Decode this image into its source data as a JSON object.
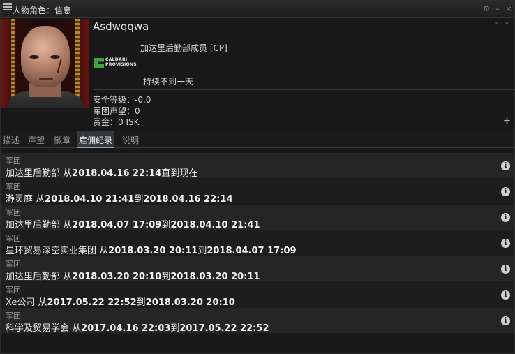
{
  "window": {
    "title": "人物角色：信息",
    "controls": {
      "settings": "⚙",
      "minimize": "–",
      "close": "×"
    },
    "nav_arrows": "« »"
  },
  "character": {
    "name": "Asdwqqwa",
    "corporation": "加达里后勤部成员 [CP]",
    "corp_logo_text": [
      "CALDARI",
      "PROVISIONS"
    ],
    "duration": "持续不到一天",
    "stats": {
      "security": "安全等级：-0.0",
      "corp_standing": "军团声望：0",
      "bounty": "赏金：0 ISK"
    }
  },
  "tabs": [
    {
      "label": "描述",
      "active": false
    },
    {
      "label": "声望",
      "active": false
    },
    {
      "label": "徽章",
      "active": false
    },
    {
      "label": "雇佣纪录",
      "active": true
    },
    {
      "label": "说明",
      "active": false
    }
  ],
  "history": [
    {
      "type": "军团",
      "corp": "加达里后勤部",
      "from_word": "从",
      "start": "2018.04.16 22:14",
      "to_word": "直到现在",
      "end": ""
    },
    {
      "type": "军团",
      "corp": "瀞灵庭",
      "from_word": "从",
      "start": "2018.04.10 21:41",
      "to_word": "到",
      "end": "2018.04.16 22:14"
    },
    {
      "type": "军团",
      "corp": "加达里后勤部",
      "from_word": "从",
      "start": "2018.04.07 17:09",
      "to_word": "到",
      "end": "2018.04.10 21:41"
    },
    {
      "type": "军团",
      "corp": "星环贸易深空实业集团",
      "from_word": "从",
      "start": "2018.03.20 20:11",
      "to_word": "到",
      "end": "2018.04.07 17:09"
    },
    {
      "type": "军团",
      "corp": "加达里后勤部",
      "from_word": "从",
      "start": "2018.03.20 20:10",
      "to_word": "到",
      "end": "2018.03.20 20:11"
    },
    {
      "type": "军团",
      "corp": "Xe公司",
      "from_word": "从",
      "start": "2017.05.22 22:52",
      "to_word": "到",
      "end": "2018.03.20 20:10"
    },
    {
      "type": "军团",
      "corp": "科学及贸易学会",
      "from_word": "从",
      "start": "2017.04.16 22:03",
      "to_word": "到",
      "end": "2017.05.22 22:52"
    }
  ],
  "icons": {
    "info": "i",
    "plus": "+"
  }
}
